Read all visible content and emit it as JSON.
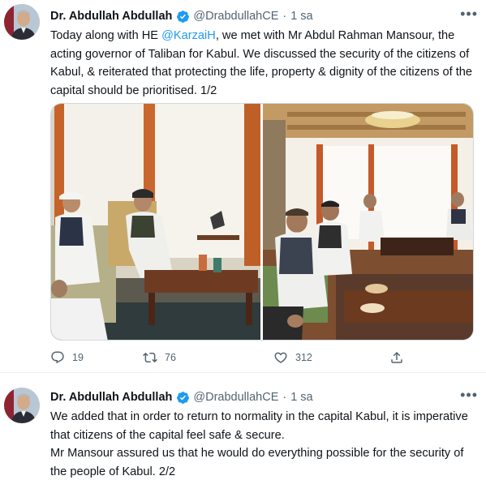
{
  "tweets": [
    {
      "author": {
        "name": "Dr. Abdullah Abdullah",
        "handle": "@DrabdullahCE",
        "verified": true,
        "avatar_icon": "profile-photo"
      },
      "separator": "·",
      "time": "1 sa",
      "more_label": "•••",
      "text_parts": {
        "before_mention": "Today along with HE ",
        "mention": "@KarzaiH",
        "after_mention": ", we met with Mr Abdul Rahman Mansour, the acting governor of Taliban for Kabul. We discussed the security of the citizens of Kabul, & reiterated that protecting the life, property & dignity of the citizens of the capital should be prioritised. 1/2"
      },
      "media": [
        "meeting-photo-left",
        "meeting-photo-right"
      ],
      "stats": {
        "replies": "19",
        "retweets": "76",
        "likes": "312"
      }
    },
    {
      "author": {
        "name": "Dr. Abdullah Abdullah",
        "handle": "@DrabdullahCE",
        "verified": true,
        "avatar_icon": "profile-photo"
      },
      "separator": "·",
      "time": "1 sa",
      "more_label": "•••",
      "text_lines": [
        "We added that in order to return to normality in the capital Kabul, it is imperative that citizens of the capital feel safe & secure.",
        "Mr Mansour assured us that he would do everything possible for the security of the people of Kabul. 2/2"
      ]
    }
  ],
  "colors": {
    "accent": "#1d9bf0",
    "muted": "#536471",
    "text": "#0f1419"
  }
}
